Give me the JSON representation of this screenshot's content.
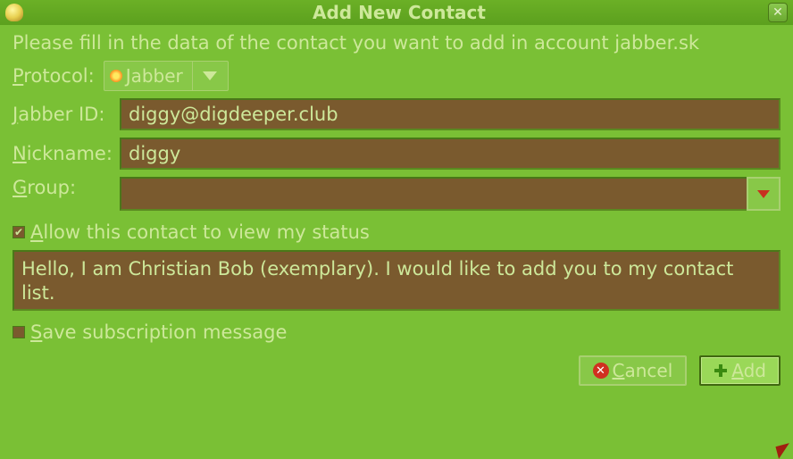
{
  "title": "Add New Contact",
  "instruction": "Please fill in the data of the contact you want to add in account jabber.sk",
  "labels": {
    "protocol": "Protocol:",
    "protocol_u": "P",
    "protocol_rest": "rotocol:",
    "jabber_id": "Jabber ID:",
    "jabber_u": "J",
    "jabber_rest": "abber ID:",
    "nickname": "Nickname:",
    "nick_u": "N",
    "nick_rest": "ickname:",
    "group": "Group:",
    "group_u": "G",
    "group_rest": "roup:",
    "allow": "Allow this contact to view my status",
    "allow_u": "A",
    "allow_rest": "llow this contact to view my status",
    "save_msg": "Save subscription message",
    "save_u": "S",
    "save_rest": "ave subscription message"
  },
  "protocol": {
    "value": "Jabber"
  },
  "fields": {
    "jabber_id": "diggy@digdeeper.club",
    "nickname": "diggy",
    "group": "",
    "message": "Hello, I am Christian Bob (exemplary). I would like to add you to my contact list."
  },
  "checkboxes": {
    "allow_status": true,
    "save_message": false
  },
  "buttons": {
    "cancel": "Cancel",
    "cancel_u": "C",
    "cancel_rest": "ancel",
    "add": "Add",
    "add_u": "A",
    "add_rest": "dd"
  }
}
